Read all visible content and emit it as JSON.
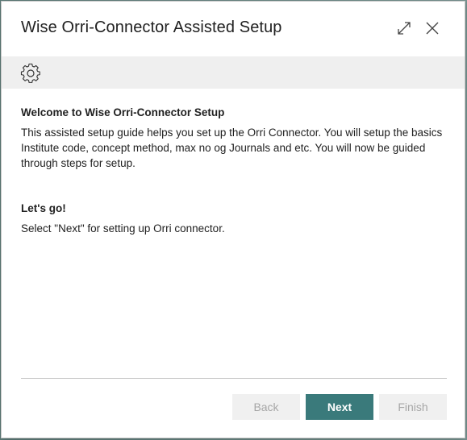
{
  "dialog": {
    "title": "Wise Orri-Connector Assisted Setup",
    "expand_icon": "expand-icon",
    "close_icon": "close-icon"
  },
  "toolbar": {
    "settings_icon": "gear-icon"
  },
  "content": {
    "welcome_heading": "Welcome to Wise Orri-Connector Setup",
    "welcome_text": "This assisted setup guide helps you set up the Orri Connector. You will setup the basics Institute code, concept method, max no og Journals and etc. You will now be guided through steps for setup.",
    "letsgo_heading": "Let's go!",
    "letsgo_text": "Select \"Next\" for setting up Orri connector."
  },
  "footer": {
    "back_label": "Back",
    "next_label": "Next",
    "finish_label": "Finish"
  },
  "colors": {
    "primary_button": "#3a7a7b",
    "toolbar_bg": "#efefef",
    "disabled_button": "#f0f0f0"
  }
}
